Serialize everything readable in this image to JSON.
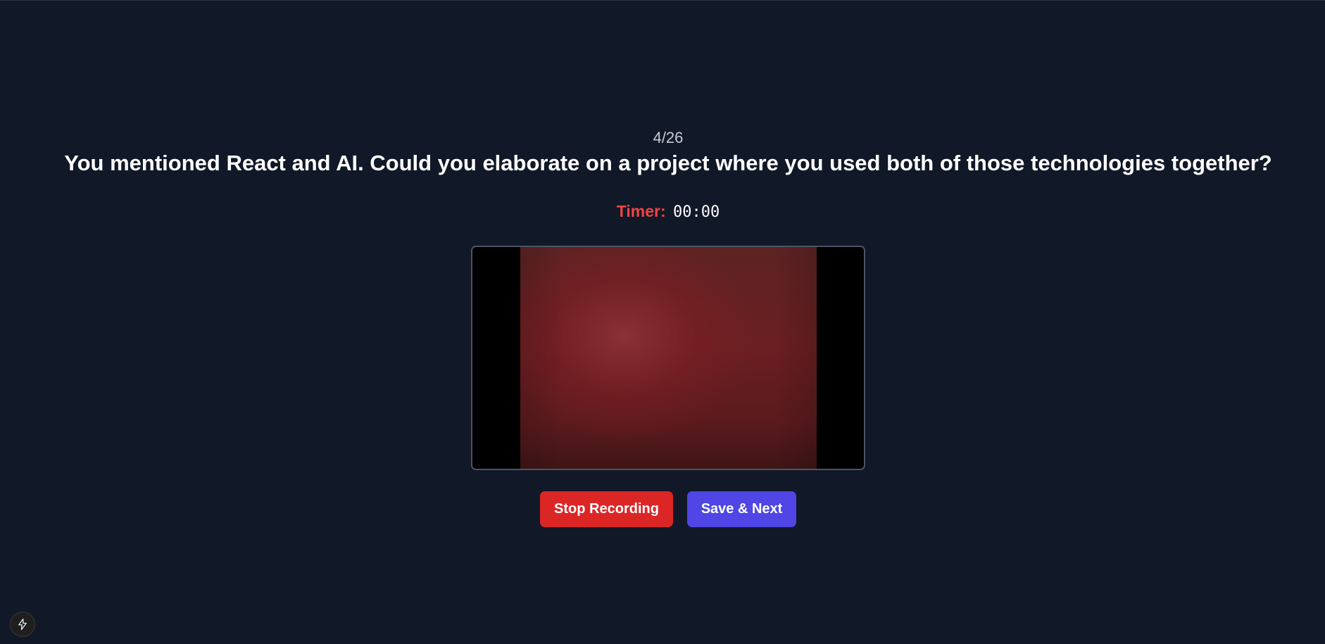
{
  "question_progress": "4/26",
  "question": "You mentioned React and AI. Could you elaborate on a project where you used both of those technologies together?",
  "timer": {
    "label": "Timer:",
    "value": "00:00"
  },
  "video": {
    "state": "recording",
    "icon": "camera-preview"
  },
  "actions": {
    "stop_label": "Stop Recording",
    "next_label": "Save & Next"
  },
  "dev_badge": {
    "icon": "lightning-icon"
  },
  "colors": {
    "background": "#111827",
    "timer_label": "#ef4444",
    "stop_button": "#dc2626",
    "next_button": "#4f46e5"
  }
}
